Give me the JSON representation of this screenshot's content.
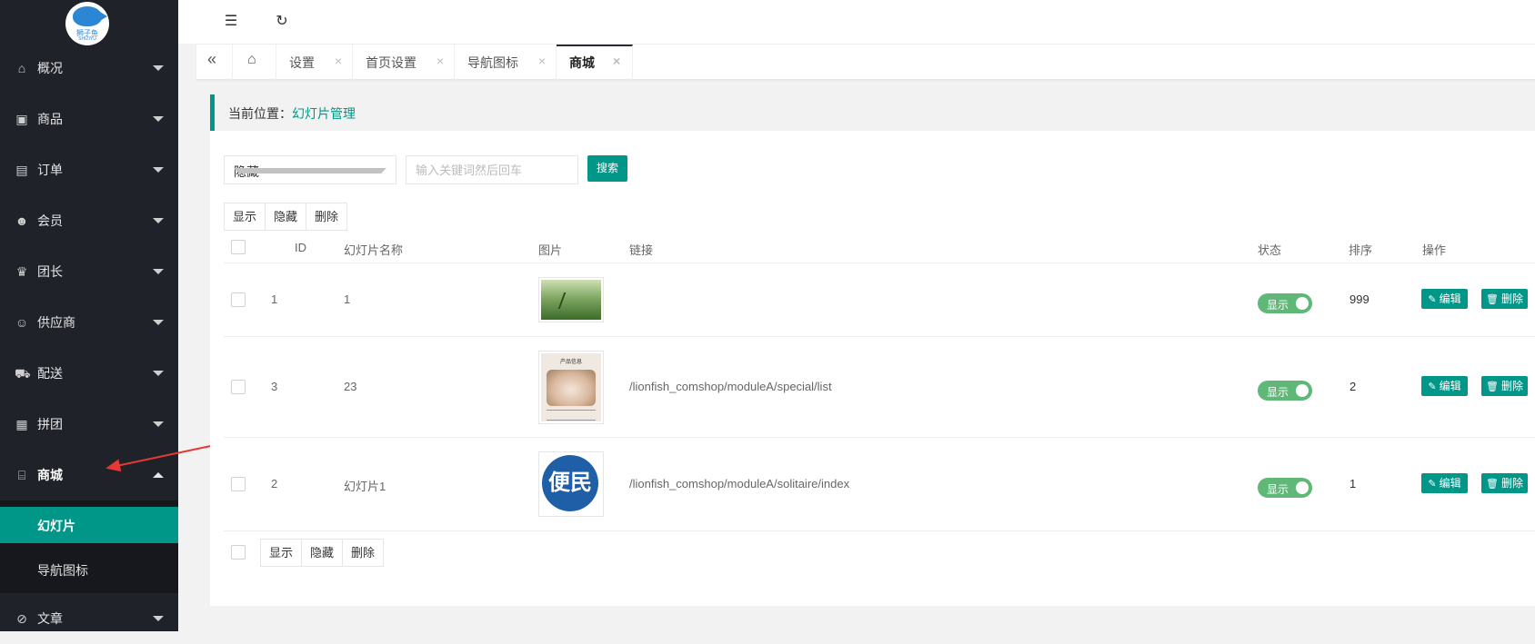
{
  "sidebar": {
    "logo": {
      "text": "狮子鱼",
      "text_en": "SHIZIYU"
    },
    "items": [
      {
        "label": "概况",
        "icon": "home-icon"
      },
      {
        "label": "商品",
        "icon": "goods-icon"
      },
      {
        "label": "订单",
        "icon": "order-icon"
      },
      {
        "label": "会员",
        "icon": "member-icon"
      },
      {
        "label": "团长",
        "icon": "crown-icon"
      },
      {
        "label": "供应商",
        "icon": "supplier-icon"
      },
      {
        "label": "配送",
        "icon": "truck-icon"
      },
      {
        "label": "拼团",
        "icon": "group-icon"
      },
      {
        "label": "商城",
        "icon": "store-icon"
      },
      {
        "label": "文章",
        "icon": "compass-icon"
      }
    ],
    "sub_items": [
      {
        "label": "幻灯片"
      },
      {
        "label": "导航图标"
      }
    ]
  },
  "tabs": [
    {
      "label": "设置"
    },
    {
      "label": "首页设置"
    },
    {
      "label": "导航图标"
    },
    {
      "label": "商城"
    }
  ],
  "breadcrumb": {
    "prefix": "当前位置：",
    "current": "幻灯片管理"
  },
  "filter": {
    "select_value": "隐藏",
    "search_placeholder": "输入关键词然后回车",
    "search_button": "搜索"
  },
  "batch": {
    "show": "显示",
    "hide": "隐藏",
    "delete": "删除"
  },
  "table": {
    "columns": {
      "id": "ID",
      "name": "幻灯片名称",
      "image": "图片",
      "link": "链接",
      "status": "状态",
      "sort": "排序",
      "ops": "操作"
    },
    "rows": [
      {
        "id": "1",
        "name": "1",
        "link": "",
        "status": "显示",
        "sort": "999"
      },
      {
        "id": "3",
        "name": "23",
        "link": "/lionfish_comshop/moduleA/special/list",
        "status": "显示",
        "sort": "2"
      },
      {
        "id": "2",
        "name": "幻灯片1",
        "link": "/lionfish_comshop/moduleA/solitaire/index",
        "status": "显示",
        "sort": "1"
      }
    ],
    "edit_label": "编辑",
    "delete_label": "删除",
    "row2_image": {
      "title": "产品信息"
    },
    "row3_image": {
      "text": "便民"
    }
  },
  "colors": {
    "accent": "#009688",
    "sidebar": "#20222a",
    "switch_on": "#5fb878",
    "arrow": "#e53935"
  }
}
